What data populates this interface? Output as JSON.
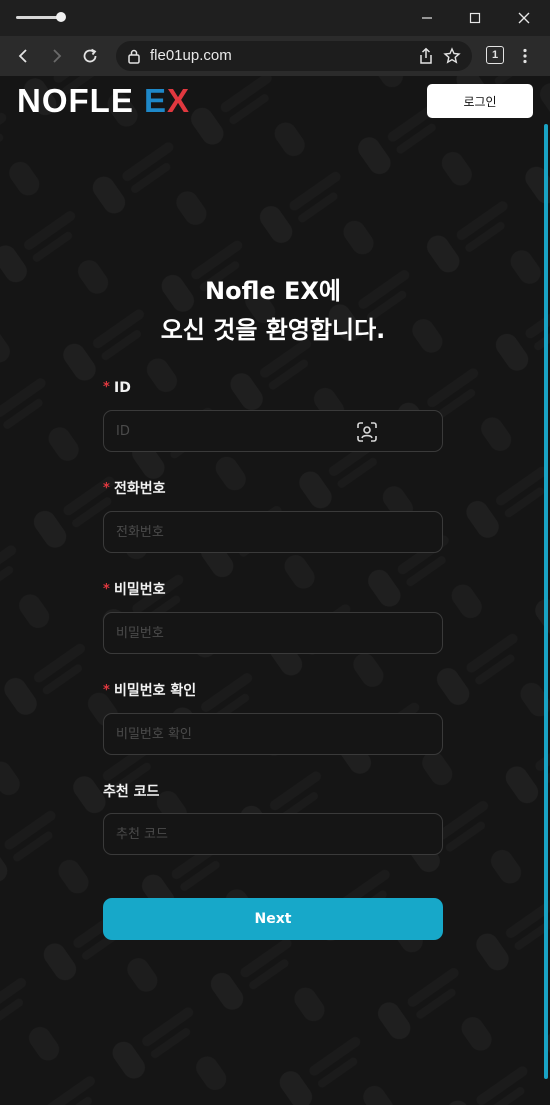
{
  "browser": {
    "url": "fle01up.com",
    "tab_count": "1",
    "minimize_glyph": "—",
    "maximize_glyph": "☐",
    "close_glyph": "✕"
  },
  "header": {
    "logo_main": "NOFLE ",
    "logo_e": "E",
    "logo_x": "X",
    "login_label": "로그인"
  },
  "welcome": {
    "line1": "Nofle EX에",
    "line2": "오신 것을 환영합니다."
  },
  "form": {
    "required_mark": "*",
    "fields": [
      {
        "label": "ID",
        "placeholder": "ID",
        "required": true
      },
      {
        "label": "전화번호",
        "placeholder": "전화번호",
        "required": true
      },
      {
        "label": "비밀번호",
        "placeholder": "비밀번호",
        "required": true
      },
      {
        "label": "비밀번호 확인",
        "placeholder": "비밀번호 확인",
        "required": true
      },
      {
        "label": "추천 코드",
        "placeholder": "추천 코드",
        "required": false
      }
    ],
    "next_label": "Next"
  },
  "colors": {
    "accent": "#17a8c9",
    "logo_e": "#1e88c8",
    "logo_x": "#e0383f",
    "required": "#e0383f",
    "background": "#151515"
  },
  "icons": {
    "face_scan": "face-scan-icon",
    "lock": "lock-icon",
    "share": "share-icon",
    "bookmark": "bookmark-star-icon"
  }
}
